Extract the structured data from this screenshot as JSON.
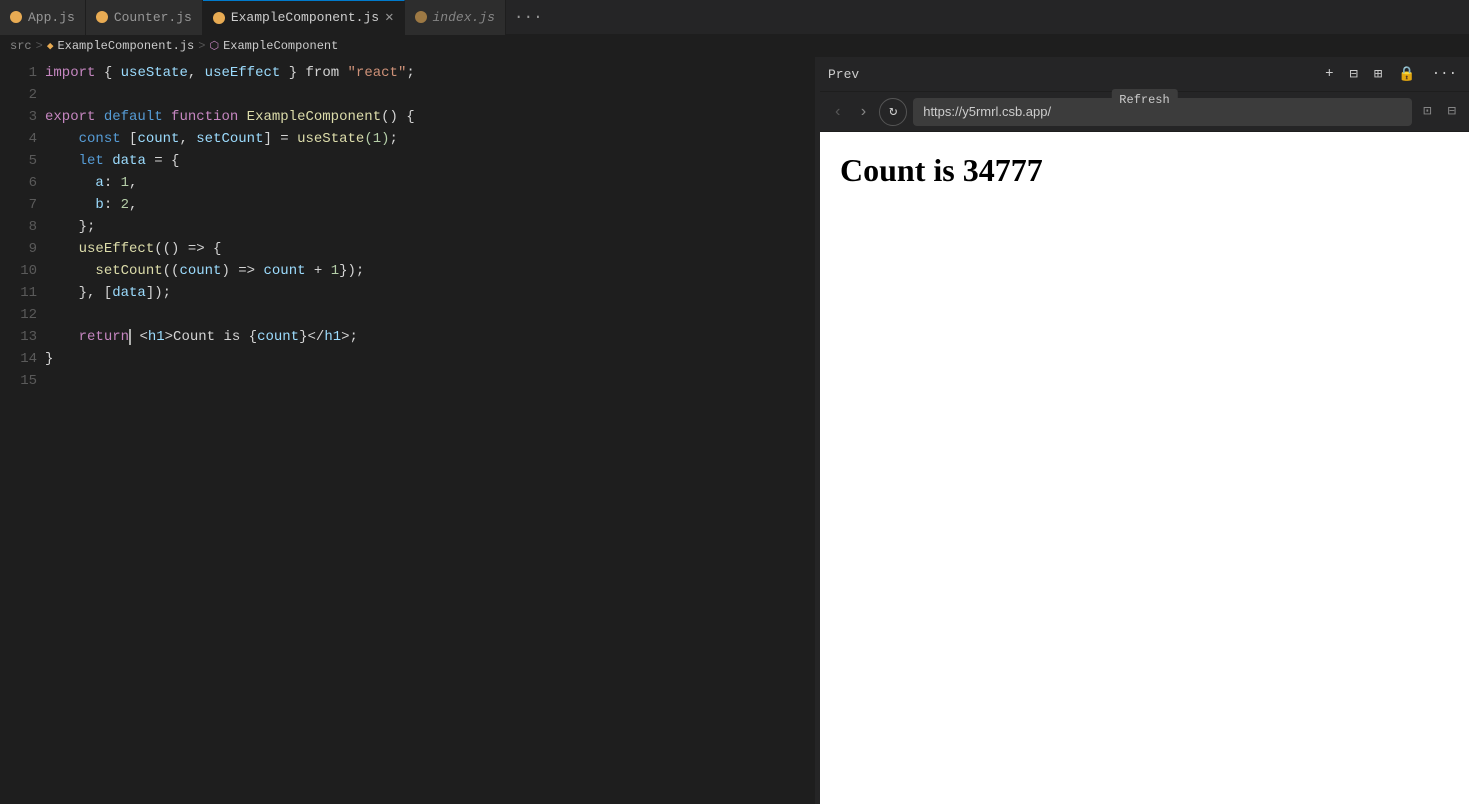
{
  "tabs": [
    {
      "id": "app-js",
      "label": "App.js",
      "icon_color": "#e8ab53",
      "active": false,
      "closeable": false
    },
    {
      "id": "counter-js",
      "label": "Counter.js",
      "icon_color": "#e8ab53",
      "active": false,
      "closeable": false
    },
    {
      "id": "example-component-js",
      "label": "ExampleComponent.js",
      "icon_color": "#e8ab53",
      "active": true,
      "closeable": true
    },
    {
      "id": "index-js",
      "label": "index.js",
      "icon_color": "#e8ab53",
      "active": false,
      "closeable": false
    }
  ],
  "tab_more_label": "···",
  "breadcrumb": {
    "src": "src",
    "sep1": ">",
    "component_icon": "◆",
    "component_name": "ExampleComponent.js",
    "sep2": ">",
    "fn_icon": "⬡",
    "fn_name": "ExampleComponent"
  },
  "code": {
    "lines": [
      {
        "num": 1,
        "tokens": [
          {
            "t": "kw-purple",
            "v": "import"
          },
          {
            "t": "plain",
            "v": " { "
          },
          {
            "t": "var-lightblue",
            "v": "useState"
          },
          {
            "t": "plain",
            "v": ", "
          },
          {
            "t": "var-lightblue",
            "v": "useEffect"
          },
          {
            "t": "plain",
            "v": " } "
          },
          {
            "t": "plain",
            "v": "from"
          },
          {
            "t": "plain",
            "v": " "
          },
          {
            "t": "str-orange",
            "v": "\"react\""
          },
          {
            "t": "plain",
            "v": ";"
          }
        ]
      },
      {
        "num": 2,
        "tokens": []
      },
      {
        "num": 3,
        "tokens": [
          {
            "t": "kw-purple",
            "v": "export"
          },
          {
            "t": "plain",
            "v": " "
          },
          {
            "t": "kw-blue",
            "v": "default"
          },
          {
            "t": "plain",
            "v": " "
          },
          {
            "t": "kw-purple",
            "v": "function"
          },
          {
            "t": "plain",
            "v": " "
          },
          {
            "t": "kw-yellow",
            "v": "ExampleComponent"
          },
          {
            "t": "plain",
            "v": "() {"
          }
        ]
      },
      {
        "num": 4,
        "tokens": [
          {
            "t": "plain",
            "v": "    "
          },
          {
            "t": "kw-blue",
            "v": "const"
          },
          {
            "t": "plain",
            "v": " ["
          },
          {
            "t": "var-lightblue",
            "v": "count"
          },
          {
            "t": "plain",
            "v": ", "
          },
          {
            "t": "var-lightblue",
            "v": "setCount"
          },
          {
            "t": "plain",
            "v": "] = "
          },
          {
            "t": "kw-yellow",
            "v": "useState"
          },
          {
            "t": "num-green",
            "v": "(1)"
          },
          {
            "t": "plain",
            "v": ";"
          }
        ]
      },
      {
        "num": 5,
        "tokens": [
          {
            "t": "plain",
            "v": "    "
          },
          {
            "t": "kw-blue",
            "v": "let"
          },
          {
            "t": "plain",
            "v": " "
          },
          {
            "t": "var-lightblue",
            "v": "data"
          },
          {
            "t": "plain",
            "v": " = {"
          }
        ]
      },
      {
        "num": 6,
        "tokens": [
          {
            "t": "plain",
            "v": "      "
          },
          {
            "t": "var-lightblue",
            "v": "a"
          },
          {
            "t": "plain",
            "v": ": "
          },
          {
            "t": "num-green",
            "v": "1"
          },
          {
            "t": "plain",
            "v": ","
          }
        ]
      },
      {
        "num": 7,
        "tokens": [
          {
            "t": "plain",
            "v": "      "
          },
          {
            "t": "var-lightblue",
            "v": "b"
          },
          {
            "t": "plain",
            "v": ": "
          },
          {
            "t": "num-green",
            "v": "2"
          },
          {
            "t": "plain",
            "v": ","
          }
        ]
      },
      {
        "num": 8,
        "tokens": [
          {
            "t": "plain",
            "v": "    };"
          }
        ]
      },
      {
        "num": 9,
        "tokens": [
          {
            "t": "plain",
            "v": "    "
          },
          {
            "t": "kw-yellow",
            "v": "useEffect"
          },
          {
            "t": "plain",
            "v": "(() => {"
          }
        ]
      },
      {
        "num": 10,
        "tokens": [
          {
            "t": "plain",
            "v": "      "
          },
          {
            "t": "kw-yellow",
            "v": "setCount"
          },
          {
            "t": "plain",
            "v": "(("
          },
          {
            "t": "var-lightblue",
            "v": "count"
          },
          {
            "t": "plain",
            "v": ") => "
          },
          {
            "t": "var-lightblue",
            "v": "count"
          },
          {
            "t": "plain",
            "v": " + "
          },
          {
            "t": "num-green",
            "v": "1"
          },
          {
            "t": "plain",
            "v": "});"
          }
        ]
      },
      {
        "num": 11,
        "tokens": [
          {
            "t": "plain",
            "v": "    }, ["
          },
          {
            "t": "var-lightblue",
            "v": "data"
          },
          {
            "t": "plain",
            "v": "]);"
          }
        ]
      },
      {
        "num": 12,
        "tokens": []
      },
      {
        "num": 13,
        "tokens": [
          {
            "t": "plain",
            "v": "    "
          },
          {
            "t": "kw-purple",
            "v": "return"
          },
          {
            "t": "plain",
            "v": " "
          },
          {
            "t": "plain",
            "v": "<"
          },
          {
            "t": "var-lightblue",
            "v": "h1"
          },
          {
            "t": "plain",
            "v": ">Count is {"
          },
          {
            "t": "var-lightblue",
            "v": "count"
          },
          {
            "t": "plain",
            "v": "}</"
          },
          {
            "t": "var-lightblue",
            "v": "h1"
          },
          {
            "t": "plain",
            "v": ">;"
          }
        ]
      },
      {
        "num": 14,
        "tokens": [
          {
            "t": "plain",
            "v": "}"
          }
        ]
      },
      {
        "num": 15,
        "tokens": []
      }
    ]
  },
  "preview": {
    "header_title": "Prev",
    "tooltip": "Refresh",
    "url": "https://y5rmrl.csb.app/",
    "content_text": "Count is 34777"
  },
  "icons": {
    "back": "‹",
    "forward": "›",
    "refresh": "↻",
    "open_new": "⊡",
    "layout_toggle": "▣",
    "layout_split": "⊞",
    "plus": "+",
    "lock": "🔒",
    "more_horiz": "···",
    "compass": "⊙",
    "shrink": "⊟"
  }
}
